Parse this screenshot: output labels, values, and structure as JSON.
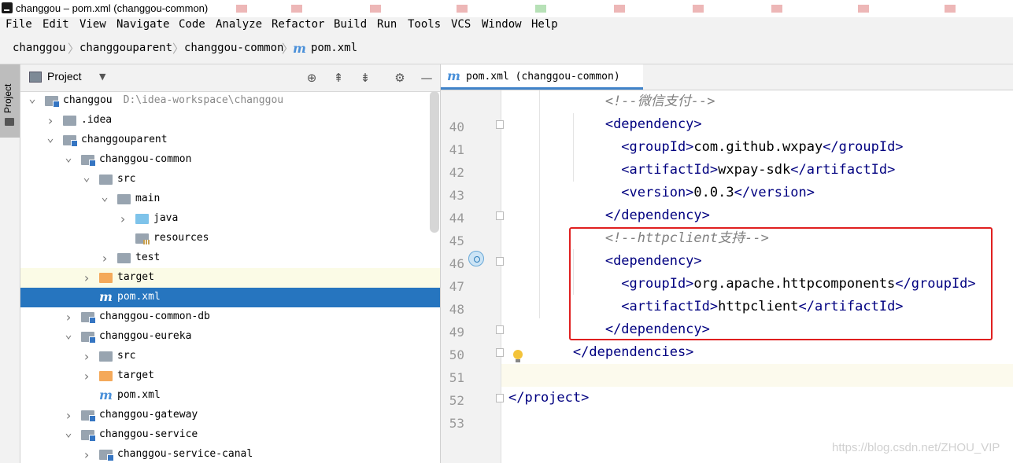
{
  "window": {
    "title": "changgou – pom.xml (changgou-common)"
  },
  "menu": [
    "File",
    "Edit",
    "View",
    "Navigate",
    "Code",
    "Analyze",
    "Refactor",
    "Build",
    "Run",
    "Tools",
    "VCS",
    "Window",
    "Help"
  ],
  "breadcrumbs": [
    "changgou",
    "changgouparent",
    "changgou-common",
    "pom.xml"
  ],
  "project_panel": {
    "vertical_tab": "Project",
    "title": "Project",
    "tree": [
      {
        "label": "changgou",
        "path": "D:\\idea-workspace\\changgou",
        "icon": "module-folder-icon",
        "arrow": "expanded"
      },
      {
        "label": ".idea",
        "icon": "folder-icon",
        "arrow": "collapsed"
      },
      {
        "label": "changgouparent",
        "icon": "module-folder-icon",
        "arrow": "expanded"
      },
      {
        "label": "changgou-common",
        "icon": "module-folder-icon",
        "arrow": "expanded"
      },
      {
        "label": "src",
        "icon": "folder-icon",
        "arrow": "expanded"
      },
      {
        "label": "main",
        "icon": "folder-icon",
        "arrow": "expanded"
      },
      {
        "label": "java",
        "icon": "source-folder-icon",
        "arrow": "collapsed"
      },
      {
        "label": "resources",
        "icon": "resources-folder-icon",
        "arrow": "none"
      },
      {
        "label": "test",
        "icon": "folder-icon",
        "arrow": "collapsed"
      },
      {
        "label": "target",
        "icon": "excluded-folder-icon",
        "arrow": "collapsed"
      },
      {
        "label": "pom.xml",
        "icon": "maven-file-icon",
        "arrow": "none"
      },
      {
        "label": "changgou-common-db",
        "icon": "module-folder-icon",
        "arrow": "collapsed"
      },
      {
        "label": "changgou-eureka",
        "icon": "module-folder-icon",
        "arrow": "expanded"
      },
      {
        "label": "src",
        "icon": "folder-icon",
        "arrow": "collapsed"
      },
      {
        "label": "target",
        "icon": "excluded-folder-icon",
        "arrow": "collapsed"
      },
      {
        "label": "pom.xml",
        "icon": "maven-file-icon",
        "arrow": "none"
      },
      {
        "label": "changgou-gateway",
        "icon": "module-folder-icon",
        "arrow": "collapsed"
      },
      {
        "label": "changgou-service",
        "icon": "module-folder-icon",
        "arrow": "expanded"
      },
      {
        "label": "changgou-service-canal",
        "icon": "module-folder-icon",
        "arrow": "collapsed"
      }
    ]
  },
  "editor": {
    "tab_label": "pom.xml (changgou-common)",
    "lines": [
      {
        "num": "40",
        "parts": [
          [
            "cmt",
            "<!--微信支付-->"
          ]
        ]
      },
      {
        "num": "41",
        "parts": [
          [
            "tag",
            "<dependency>"
          ]
        ]
      },
      {
        "num": "42",
        "parts": [
          [
            "tag",
            "<groupId>"
          ],
          [
            "txt",
            "com.github.wxpay"
          ],
          [
            "tag",
            "</groupId>"
          ]
        ]
      },
      {
        "num": "43",
        "parts": [
          [
            "tag",
            "<artifactId>"
          ],
          [
            "txt",
            "wxpay-sdk"
          ],
          [
            "tag",
            "</artifactId>"
          ]
        ]
      },
      {
        "num": "44",
        "parts": [
          [
            "tag",
            "<version>"
          ],
          [
            "txt",
            "0.0.3"
          ],
          [
            "tag",
            "</version>"
          ]
        ]
      },
      {
        "num": "45",
        "parts": [
          [
            "tag",
            "</dependency>"
          ]
        ]
      },
      {
        "num": "46",
        "parts": [
          [
            "cmt",
            "<!--httpclient支持-->"
          ]
        ]
      },
      {
        "num": "47",
        "parts": [
          [
            "tag",
            "<dependency>"
          ]
        ]
      },
      {
        "num": "48",
        "parts": [
          [
            "tag",
            "<groupId>"
          ],
          [
            "txt",
            "org.apache.httpcomponents"
          ],
          [
            "tag",
            "</groupId>"
          ]
        ]
      },
      {
        "num": "49",
        "parts": [
          [
            "tag",
            "<artifactId>"
          ],
          [
            "txt",
            "httpclient"
          ],
          [
            "tag",
            "</artifactId>"
          ]
        ]
      },
      {
        "num": "50",
        "parts": [
          [
            "tag",
            "</dependency>"
          ]
        ]
      },
      {
        "num": "51",
        "parts": [
          [
            "tag",
            "</dependencies>"
          ]
        ]
      },
      {
        "num": "52",
        "parts": []
      },
      {
        "num": "53",
        "parts": [
          [
            "tag",
            "</project>"
          ]
        ]
      }
    ]
  },
  "watermark": "https://blog.csdn.net/ZHOU_VIP",
  "colors": {
    "selection": "#2675bf",
    "tag": "#000080",
    "comment": "#808080",
    "highlight_box": "#e02020"
  }
}
